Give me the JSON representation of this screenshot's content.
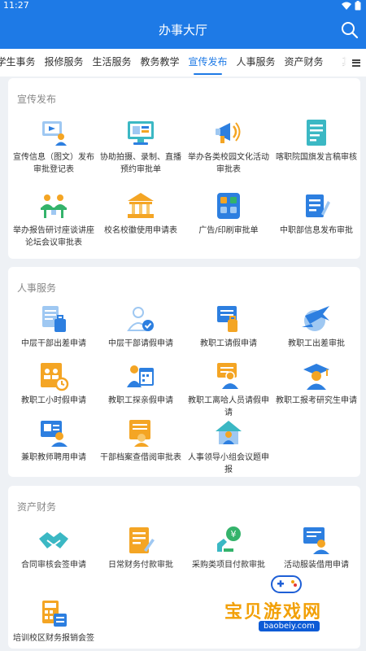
{
  "status_bar": {
    "time": "11:27"
  },
  "header": {
    "title": "办事大厅"
  },
  "tabs": [
    {
      "label": "学生事务"
    },
    {
      "label": "报修服务"
    },
    {
      "label": "生活服务"
    },
    {
      "label": "教务教学"
    },
    {
      "label": "宣传发布",
      "active": true
    },
    {
      "label": "人事服务"
    },
    {
      "label": "资产财务"
    },
    {
      "label": "其他"
    }
  ],
  "sections": [
    {
      "title": "宣传发布",
      "items": [
        {
          "label": "宣传信息（图文）发布审批登记表",
          "icon": "monitor-person-icon"
        },
        {
          "label": "协助拍摄、录制、直播预约审批单",
          "icon": "screen-presentation-icon"
        },
        {
          "label": "举办各类校园文化活动审批表",
          "icon": "megaphone-icon"
        },
        {
          "label": "喀职院国旗发言稿审核",
          "icon": "document-icon"
        },
        {
          "label": "举办报告研讨座谈讲座论坛会议审批表",
          "icon": "meeting-icon"
        },
        {
          "label": "校名校徽使用申请表",
          "icon": "building-icon"
        },
        {
          "label": "广告/印刷审批单",
          "icon": "apps-icon"
        },
        {
          "label": "中职部信息发布审批",
          "icon": "edit-document-icon"
        }
      ]
    },
    {
      "title": "人事服务",
      "items": [
        {
          "label": "中层干部出差申请",
          "icon": "luggage-doc-icon"
        },
        {
          "label": "中层干部请假申请",
          "icon": "person-check-icon"
        },
        {
          "label": "教职工请假申请",
          "icon": "doc-luggage-icon"
        },
        {
          "label": "教职工出差审批",
          "icon": "globe-plane-icon"
        },
        {
          "label": "教职工小时假申请",
          "icon": "team-clock-icon"
        },
        {
          "label": "教职工探亲假申请",
          "icon": "person-calendar-icon"
        },
        {
          "label": "教职工离哈人员请假申请",
          "icon": "person-pass-icon"
        },
        {
          "label": "教职工报考研究生申请",
          "icon": "graduate-icon"
        },
        {
          "label": "兼职教师聘用申请",
          "icon": "person-card-icon"
        },
        {
          "label": "干部档案查借阅审批表",
          "icon": "archive-icon"
        },
        {
          "label": "人事领导小组会议题申报",
          "icon": "house-person-icon"
        }
      ]
    },
    {
      "title": "资产财务",
      "items": [
        {
          "label": "合同审核会签申请",
          "icon": "handshake-icon"
        },
        {
          "label": "日常财务付款审批",
          "icon": "payment-doc-icon"
        },
        {
          "label": "采购类项目付款审批",
          "icon": "yuan-plug-icon"
        },
        {
          "label": "活动服装借用申请",
          "icon": "person-doc-icon"
        },
        {
          "label": "培训校区财务报销会签",
          "icon": "calculator-icon"
        }
      ]
    }
  ],
  "watermark": {
    "text": "宝贝游戏网",
    "url": "baobeiy.com"
  }
}
